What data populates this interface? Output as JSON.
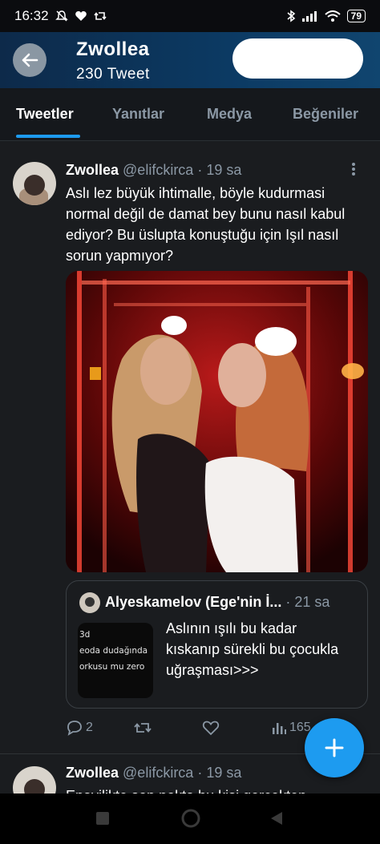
{
  "status_bar": {
    "time": "16:32",
    "battery": "79",
    "left_icons": [
      "mute-icon",
      "heart-icon",
      "retweet-icon"
    ],
    "right_icons": [
      "bluetooth-icon",
      "signal-icon",
      "wifi-icon",
      "battery-icon"
    ]
  },
  "header": {
    "title": "Zwollea",
    "subtitle": "230 Tweet",
    "back_icon": "arrow-left-icon"
  },
  "tabs": [
    {
      "label": "Tweetler",
      "active": true
    },
    {
      "label": "Yanıtlar",
      "active": false
    },
    {
      "label": "Medya",
      "active": false
    },
    {
      "label": "Beğeniler",
      "active": false
    }
  ],
  "tweets": [
    {
      "name": "Zwollea",
      "handle": "@elifckirca",
      "time": "· 19 sa",
      "text": "Aslı lez büyük ihtimalle, böyle kudurmasi normal değil de damat bey bunu nasıl kabul ediyor? Bu üslupta konuştuğu için Işıl nasıl sorun yapmıyor?",
      "quote": {
        "name": "Alyeskamelov (Ege'nin İ...",
        "time": "· 21 sa",
        "thumb_lines": [
          "3d",
          "eoda dudağında",
          "orkusu mu zero"
        ],
        "text": "Aslının ışılı bu kadar kıskanıp sürekli bu çocukla uğraşması>>>"
      },
      "actions": {
        "reply_count": "2",
        "retweet_count": "",
        "like_count": "",
        "views_count": "165"
      }
    },
    {
      "name": "Zwollea",
      "handle": "@elifckirca",
      "time": "· 19 sa",
      "text": "Enayilikte son nokta bu kişi gerçekten"
    }
  ],
  "colors": {
    "accent": "#1d9bf0",
    "header_bg": "#0c3a63",
    "feed_bg": "#1a1c1f",
    "muted": "#8b98a5"
  },
  "fab": {
    "icon": "plus-icon"
  }
}
